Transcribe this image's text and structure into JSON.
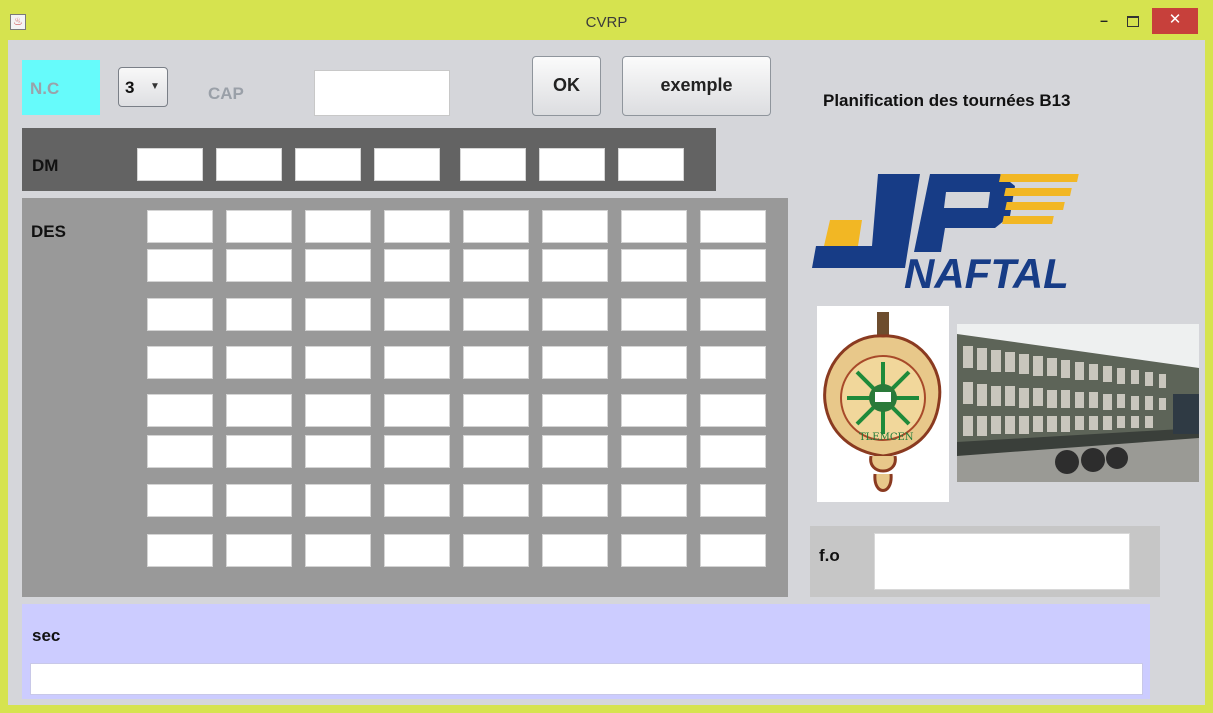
{
  "window": {
    "title": "CVRP",
    "minimize_glyph": "–",
    "close_glyph": "✕",
    "app_icon": "java-coffee-icon"
  },
  "controls": {
    "nc_label": "N.C",
    "nc_value": "3",
    "cap_label": "CAP",
    "cap_value": "",
    "ok_label": "OK",
    "example_label": "exemple"
  },
  "header": {
    "title": "Planification des tournées B13"
  },
  "dm": {
    "label": "DM",
    "fields": [
      "",
      "",
      "",
      "",
      "",
      "",
      ""
    ]
  },
  "des": {
    "label": "DES",
    "rows": [
      [
        "",
        "",
        "",
        "",
        "",
        "",
        "",
        ""
      ],
      [
        "",
        "",
        "",
        "",
        "",
        "",
        "",
        ""
      ],
      [
        "",
        "",
        "",
        "",
        "",
        "",
        "",
        ""
      ],
      [
        "",
        "",
        "",
        "",
        "",
        "",
        "",
        ""
      ],
      [
        "",
        "",
        "",
        "",
        "",
        "",
        "",
        ""
      ],
      [
        "",
        "",
        "",
        "",
        "",
        "",
        "",
        ""
      ],
      [
        "",
        "",
        "",
        "",
        "",
        "",
        "",
        ""
      ],
      [
        "",
        "",
        "",
        "",
        "",
        "",
        "",
        ""
      ]
    ]
  },
  "logos": {
    "naftal_text": "NAFTAL",
    "seal_text": "TLEMCEN",
    "seal": "university-seal-image",
    "truck": "gas-cylinder-truck-photo"
  },
  "fo": {
    "label": "f.o",
    "value": ""
  },
  "sec": {
    "label": "sec",
    "value": ""
  },
  "colors": {
    "titlebar": "#d6e34f",
    "nc_bg": "#66fbfb",
    "dm_bg": "#636363",
    "des_bg": "#999999",
    "sec_bg": "#ccccff",
    "naftal_blue": "#173c86",
    "naftal_yellow": "#f2b724",
    "close_red": "#c7403b"
  }
}
